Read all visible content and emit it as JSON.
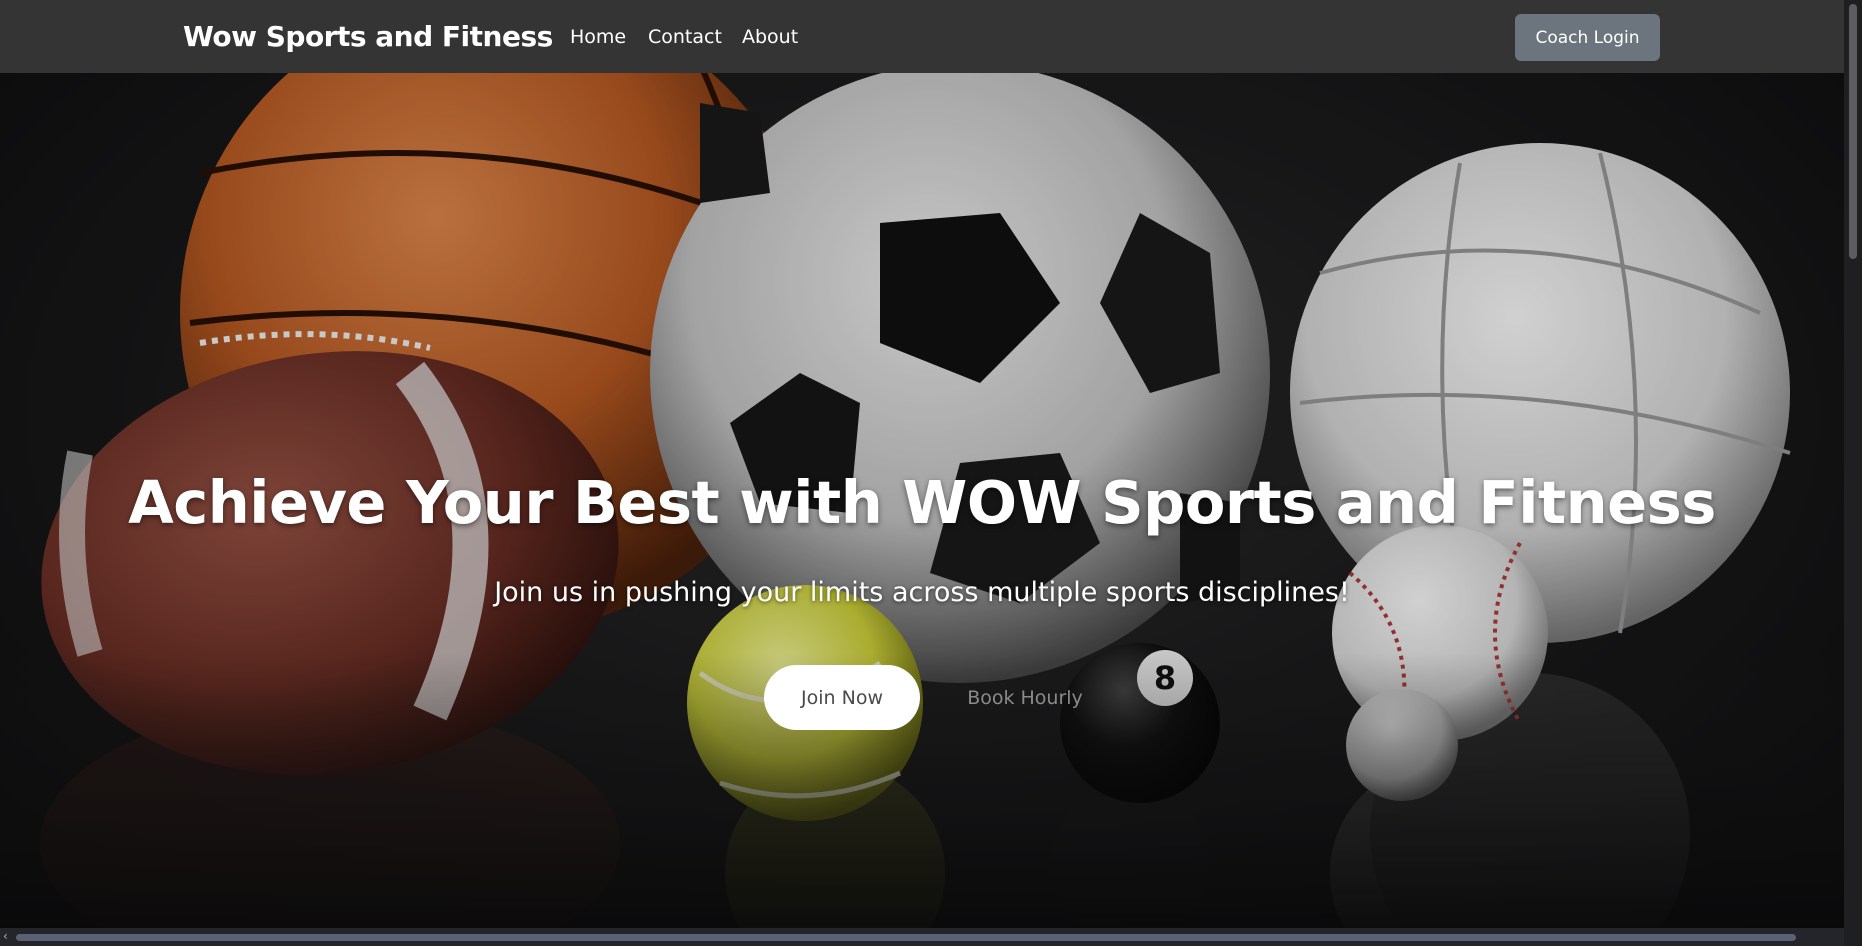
{
  "navbar": {
    "brand": "Wow Sports and Fitness",
    "links": [
      "Home",
      "Contact",
      "About"
    ],
    "coach_login": "Coach Login"
  },
  "hero": {
    "title": "Achieve Your Best with WOW Sports and Fitness",
    "subtitle": "Join us in pushing your limits across multiple sports disciplines!",
    "join_button": "Join Now",
    "book_button": "Book Hourly",
    "background_image": "sports balls: basketball, american football, soccer ball, volleyball, tennis ball, baseball, golf ball, eight ball"
  },
  "colors": {
    "navbar_bg": "#343435",
    "coach_button_bg": "#6c757d",
    "join_button_bg": "#ffffff",
    "book_button_text": "#8a8a8a",
    "hero_bg": "#1a1a1b"
  },
  "scrollbars": {
    "horizontal_left_arrow": "‹"
  }
}
